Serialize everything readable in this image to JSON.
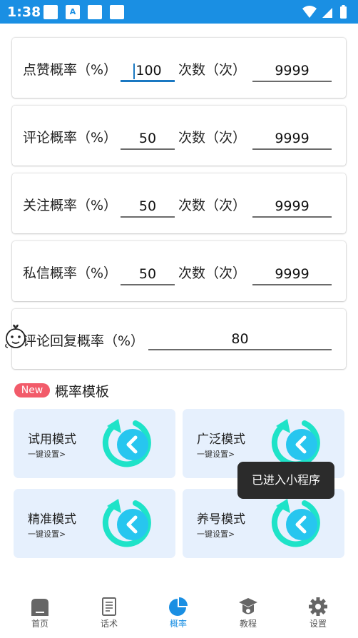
{
  "status_bar": {
    "time": "1:38",
    "a_icon_letter": "A"
  },
  "settings": [
    {
      "label": "点赞概率（%）",
      "rate": "100",
      "count_label": "次数（次）",
      "count": "9999"
    },
    {
      "label": "评论概率（%）",
      "rate": "50",
      "count_label": "次数（次）",
      "count": "9999"
    },
    {
      "label": "关注概率（%）",
      "rate": "50",
      "count_label": "次数（次）",
      "count": "9999"
    },
    {
      "label": "私信概率（%）",
      "rate": "50",
      "count_label": "次数（次）",
      "count": "9999"
    }
  ],
  "reply_setting": {
    "label": "评论回复概率（%）",
    "value": "80"
  },
  "templates_section": {
    "badge": "New",
    "title": "概率模板"
  },
  "templates": [
    {
      "name": "试用模式",
      "subtitle": "一键设置>"
    },
    {
      "name": "广泛模式",
      "subtitle": "一键设置>"
    },
    {
      "name": "精准模式",
      "subtitle": "一键设置>"
    },
    {
      "name": "养号模式",
      "subtitle": "一键设置>"
    }
  ],
  "toast": {
    "text": "已进入小程序"
  },
  "bottom_nav": [
    {
      "label": "首页",
      "icon": "home-icon"
    },
    {
      "label": "话术",
      "icon": "document-icon"
    },
    {
      "label": "概率",
      "icon": "pie-chart-icon",
      "active": true
    },
    {
      "label": "教程",
      "icon": "graduation-cap-icon"
    },
    {
      "label": "设置",
      "icon": "gear-icon"
    }
  ],
  "colors": {
    "primary": "#1a8fe3",
    "accent_teal": "#1ee3c8",
    "badge": "#f25b6a",
    "template_bg": "#e6f0fd"
  }
}
